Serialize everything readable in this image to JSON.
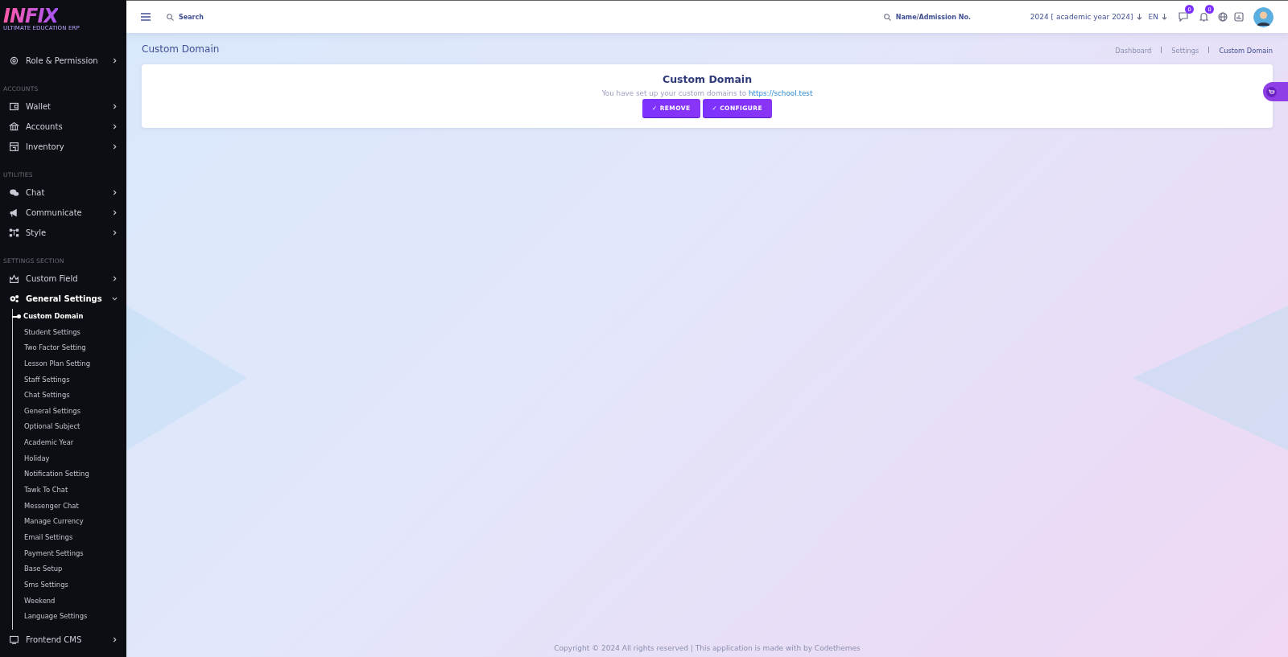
{
  "sidebar": {
    "logo": "INFIX",
    "tagline": "ULTIMATE EDUCATION ERP",
    "groups": [
      {
        "items": [
          {
            "label": "Role & Permission",
            "expanded": false
          }
        ]
      },
      {
        "heading": "ACCOUNTS",
        "items": [
          {
            "label": "Wallet",
            "expanded": false
          },
          {
            "label": "Accounts",
            "expanded": false
          },
          {
            "label": "Inventory",
            "expanded": false
          }
        ]
      },
      {
        "heading": "UTILITIES",
        "items": [
          {
            "label": "Chat",
            "expanded": false
          },
          {
            "label": "Communicate",
            "expanded": false
          },
          {
            "label": "Style",
            "expanded": false
          }
        ]
      },
      {
        "heading": "SETTINGS SECTION",
        "items": [
          {
            "label": "Custom Field",
            "expanded": false
          },
          {
            "label": "General Settings",
            "expanded": true,
            "children": [
              {
                "label": "Custom Domain",
                "selected": true
              },
              {
                "label": "Student Settings",
                "selected": false
              },
              {
                "label": "Two Factor Setting",
                "selected": false
              },
              {
                "label": "Lesson Plan Setting",
                "selected": false
              },
              {
                "label": "Staff Settings",
                "selected": false
              },
              {
                "label": "Chat Settings",
                "selected": false
              },
              {
                "label": "General Settings",
                "selected": false
              },
              {
                "label": "Optional Subject",
                "selected": false
              },
              {
                "label": "Academic Year",
                "selected": false
              },
              {
                "label": "Holiday",
                "selected": false
              },
              {
                "label": "Notification Setting",
                "selected": false
              },
              {
                "label": "Tawk To Chat",
                "selected": false
              },
              {
                "label": "Messenger Chat",
                "selected": false
              },
              {
                "label": "Manage Currency",
                "selected": false
              },
              {
                "label": "Email Settings",
                "selected": false
              },
              {
                "label": "Payment Settings",
                "selected": false
              },
              {
                "label": "Base Setup",
                "selected": false
              },
              {
                "label": "Sms Settings",
                "selected": false
              },
              {
                "label": "Weekend",
                "selected": false
              },
              {
                "label": "Language Settings",
                "selected": false
              }
            ]
          },
          {
            "label": "Frontend CMS",
            "expanded": false
          }
        ]
      }
    ]
  },
  "topbar": {
    "search": {
      "placeholder": "Search"
    },
    "student_search": {
      "placeholder": "Name/Admission No."
    },
    "session": "2024 [ academic year 2024]",
    "language": "EN",
    "messages_count": "0",
    "notifications_count": "0"
  },
  "page": {
    "title": "Custom Domain",
    "breadcrumb": [
      {
        "label": "Dashboard",
        "selected": false
      },
      {
        "label": "Settings",
        "selected": false
      },
      {
        "label": "Custom Domain",
        "selected": true
      }
    ]
  },
  "card": {
    "title": "Custom Domain",
    "text": "You have set up your custom domains to",
    "link": "https://school.test",
    "buttons": [
      "✓ REMOVE",
      "✓ CONFIGURE"
    ]
  },
  "footer": "Copyright © 2024 All rights reserved | This application is made with by Codethemes"
}
